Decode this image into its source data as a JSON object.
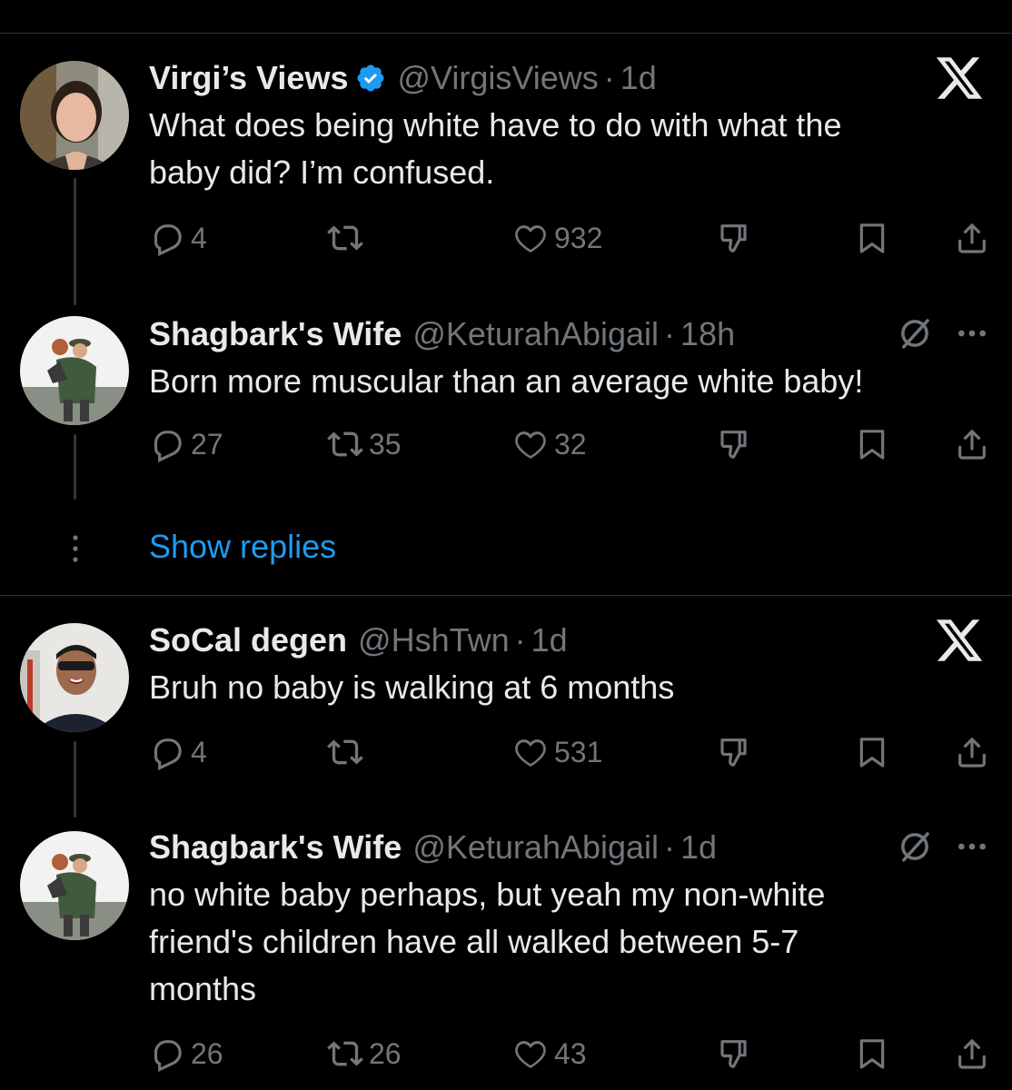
{
  "colors": {
    "background": "#000000",
    "text": "#e7e9ea",
    "muted": "#71767b",
    "link": "#1d9bf0",
    "verified": "#1d9bf0",
    "divider": "#2f3336"
  },
  "tweets": [
    {
      "name": "Virgi’s Views",
      "verified": true,
      "handle": "@VirgisViews",
      "sep": "·",
      "time": "1d",
      "text": "What does being white have to do with what the\nbaby did? I’m confused.",
      "header_icon": "x-close-icon",
      "replies": "4",
      "retweets": "",
      "likes": "932"
    },
    {
      "name": "Shagbark's Wife",
      "verified": false,
      "handle": "@KeturahAbigail",
      "sep": "·",
      "time": "18h",
      "text": "Born more muscular than an average white baby!",
      "header_icon": "more-icon",
      "replies": "27",
      "retweets": "35",
      "likes": "32"
    },
    {
      "name": "SoCal degen",
      "verified": false,
      "handle": "@HshTwn",
      "sep": "·",
      "time": "1d",
      "text": "Bruh no baby is walking at 6 months",
      "header_icon": "x-close-icon",
      "replies": "4",
      "retweets": "",
      "likes": "531"
    },
    {
      "name": "Shagbark's Wife",
      "verified": false,
      "handle": "@KeturahAbigail",
      "sep": "·",
      "time": "1d",
      "text": "no white baby perhaps, but yeah my non-white\nfriend's children have all walked between 5-7\nmonths",
      "header_icon": "more-icon",
      "replies": "26",
      "retweets": "26",
      "likes": "43"
    }
  ],
  "show_replies_label": "Show replies"
}
